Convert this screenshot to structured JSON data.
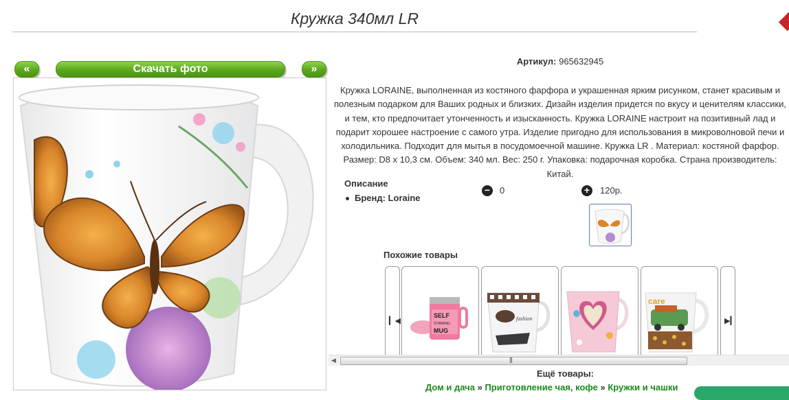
{
  "page": {
    "title": "Кружка 340мл LR"
  },
  "gallery": {
    "prev_label": "«",
    "download_label": "Скачать фото",
    "next_label": "»"
  },
  "product": {
    "sku_label": "Артикул:",
    "sku_value": "965632945",
    "description": "Кружка LORAINE, выполненная из костяного фарфора и украшенная ярким рисунком, станет красивым и полезным подарком для Ваших родных и близких. Дизайн изделия придется по вкусу и ценителям классики, и тем, кто предпочитает утонченность и изысканность. Кружка LORAINE настроит на позитивный лад и подарит хорошее настроение с самого утра. Изделие пригодно для использования в микроволновой печи и холодильника. Подходит для мытья в посудомоечной машине. Кружка LR . Материал: костяной фарфор. Размер: D8 х 10,3 см. Объем: 340 мл. Вес: 250 г. Упаковка: подарочная коробка. Страна производитель: Китай.",
    "description_heading": "Описание",
    "brand_line": "Бренд: Loraine",
    "quantity": "0",
    "price": "120р.",
    "minus_icon": "minus-circle-icon",
    "plus_icon": "plus-circle-icon"
  },
  "similar": {
    "heading": "Похожие товары",
    "items": [
      {
        "name": "self-stirring-mug",
        "label": "SELF STIRRING MUG"
      },
      {
        "name": "fashion-mug",
        "label": "fashion"
      },
      {
        "name": "heart-mug",
        "label": ""
      },
      {
        "name": "retro-car-mug",
        "label": "care"
      }
    ]
  },
  "more": {
    "heading": "Ещё товары:",
    "crumbs": [
      "Дом и дача",
      "Приготовление чая, кофе",
      "Кружки и чашки"
    ],
    "separator": "»"
  },
  "colors": {
    "accent_green": "#5aa71c",
    "link_green": "#1a8a1a",
    "brand_red": "#c6252b"
  }
}
